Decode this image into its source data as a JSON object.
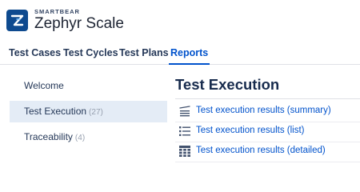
{
  "brand": {
    "company": "SMARTBEAR",
    "product": "Zephyr Scale",
    "logo_icon": "zephyr-logo-icon",
    "accent_color": "#0052cc"
  },
  "tabs": [
    {
      "label": "Test Cases",
      "active": false
    },
    {
      "label": "Test Cycles",
      "active": false
    },
    {
      "label": "Test Plans",
      "active": false
    },
    {
      "label": "Reports",
      "active": true
    }
  ],
  "sidebar": {
    "items": [
      {
        "label": "Welcome",
        "count": ""
      },
      {
        "label": "Test Execution",
        "count": "(27)",
        "selected": true
      },
      {
        "label": "Traceability",
        "count": "(4)"
      }
    ]
  },
  "main": {
    "title": "Test Execution",
    "reports": [
      {
        "label": "Test execution results (summary)",
        "icon": "summary-chart-icon"
      },
      {
        "label": "Test execution results (list)",
        "icon": "list-icon"
      },
      {
        "label": "Test execution results (detailed)",
        "icon": "grid-table-icon"
      }
    ]
  }
}
